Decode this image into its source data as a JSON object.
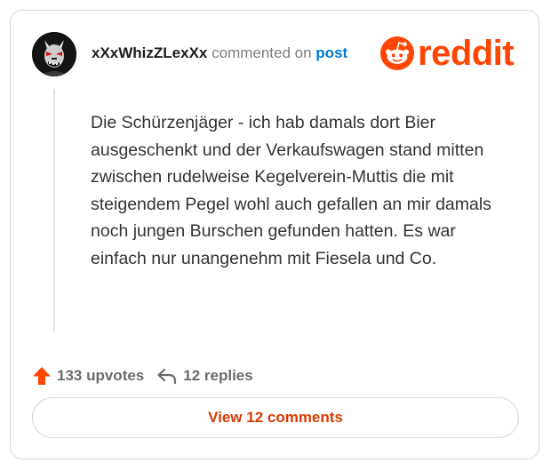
{
  "comment": {
    "username": "xXxWhizZLexXx",
    "action_text": "commented on",
    "post_link": "post",
    "body": "Die Schürzenjäger - ich hab damals dort Bier ausgeschenkt und der Verkaufswagen stand mitten zwischen rudelweise Kegelverein-Muttis die mit steigendem Pegel wohl auch gefallen an mir damals noch jungen Burschen gefunden hatten. Es war einfach nur unangenehm mit Fiesela und Co."
  },
  "brand": {
    "logo_text": "reddit",
    "icon": "reddit-snoo-icon"
  },
  "stats": {
    "upvotes": "133 upvotes",
    "replies": "12 replies",
    "upvote_icon": "upvote-arrow-icon",
    "reply_icon": "reply-arrow-icon"
  },
  "footer": {
    "view_comments_label": "View 12 comments"
  },
  "colors": {
    "brand": "#ff4500",
    "link": "#0079d3",
    "button_text": "#d93a00",
    "border": "#d6d6d6",
    "muted": "#7c7c7c"
  }
}
